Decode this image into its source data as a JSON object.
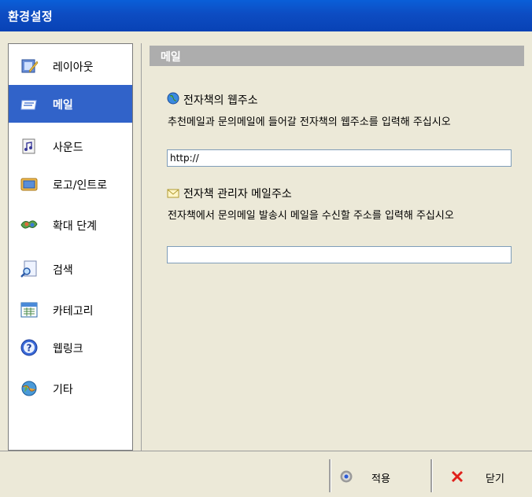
{
  "window": {
    "title": "환경설정"
  },
  "sidebar": {
    "items": [
      {
        "label": "레이아웃",
        "icon": "layout-icon"
      },
      {
        "label": "메일",
        "icon": "mail-icon"
      },
      {
        "label": "사운드",
        "icon": "sound-icon"
      },
      {
        "label": "로고/인트로",
        "icon": "logo-icon"
      },
      {
        "label": "확대 단계",
        "icon": "zoom-icon"
      },
      {
        "label": "검색",
        "icon": "search-icon"
      },
      {
        "label": "카테고리",
        "icon": "category-icon"
      },
      {
        "label": "웹링크",
        "icon": "weblink-icon"
      },
      {
        "label": "기타",
        "icon": "misc-icon"
      }
    ],
    "selected": "메일"
  },
  "main": {
    "section_title": "메일",
    "web_address": {
      "title": "전자책의 웹주소",
      "description": "추천메일과 문의메일에 들어갈 전자책의 웹주소를 입력해 주십시오",
      "value": "http://"
    },
    "admin_email": {
      "title": "전자책 관리자 메일주소",
      "description": "전자책에서 문의메일 발송시 메일을 수신할 주소를 입력해 주십시오",
      "value": ""
    }
  },
  "footer": {
    "apply_label": "적용",
    "close_label": "닫기"
  },
  "colors": {
    "titlebar": "#0a4fc8",
    "selected_item": "#3163c9",
    "section_header": "#adadad",
    "close_x": "#e0201a"
  }
}
